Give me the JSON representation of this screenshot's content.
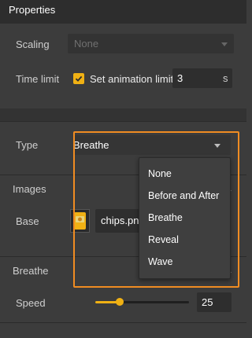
{
  "header": {
    "title": "Properties"
  },
  "scaling": {
    "label": "Scaling",
    "value": "None"
  },
  "time_limit": {
    "label": "Time limit",
    "checkbox_label": "Set animation limit",
    "checked": true,
    "value": "3",
    "unit": "s"
  },
  "type": {
    "label": "Type",
    "value": "Breathe"
  },
  "images": {
    "section_label": "Images",
    "base_label": "Base",
    "file_name": "chips.png"
  },
  "breathe": {
    "section_label": "Breathe",
    "speed_label": "Speed",
    "speed_value": "25",
    "speed_fraction": 0.25
  },
  "dropdown": {
    "options": [
      "None",
      "Before and After",
      "Breathe",
      "Reveal",
      "Wave"
    ]
  },
  "colors": {
    "accent": "#f0b114",
    "highlight": "#f08c22",
    "background": "#3c3c3c",
    "header": "#2d2d2d"
  }
}
